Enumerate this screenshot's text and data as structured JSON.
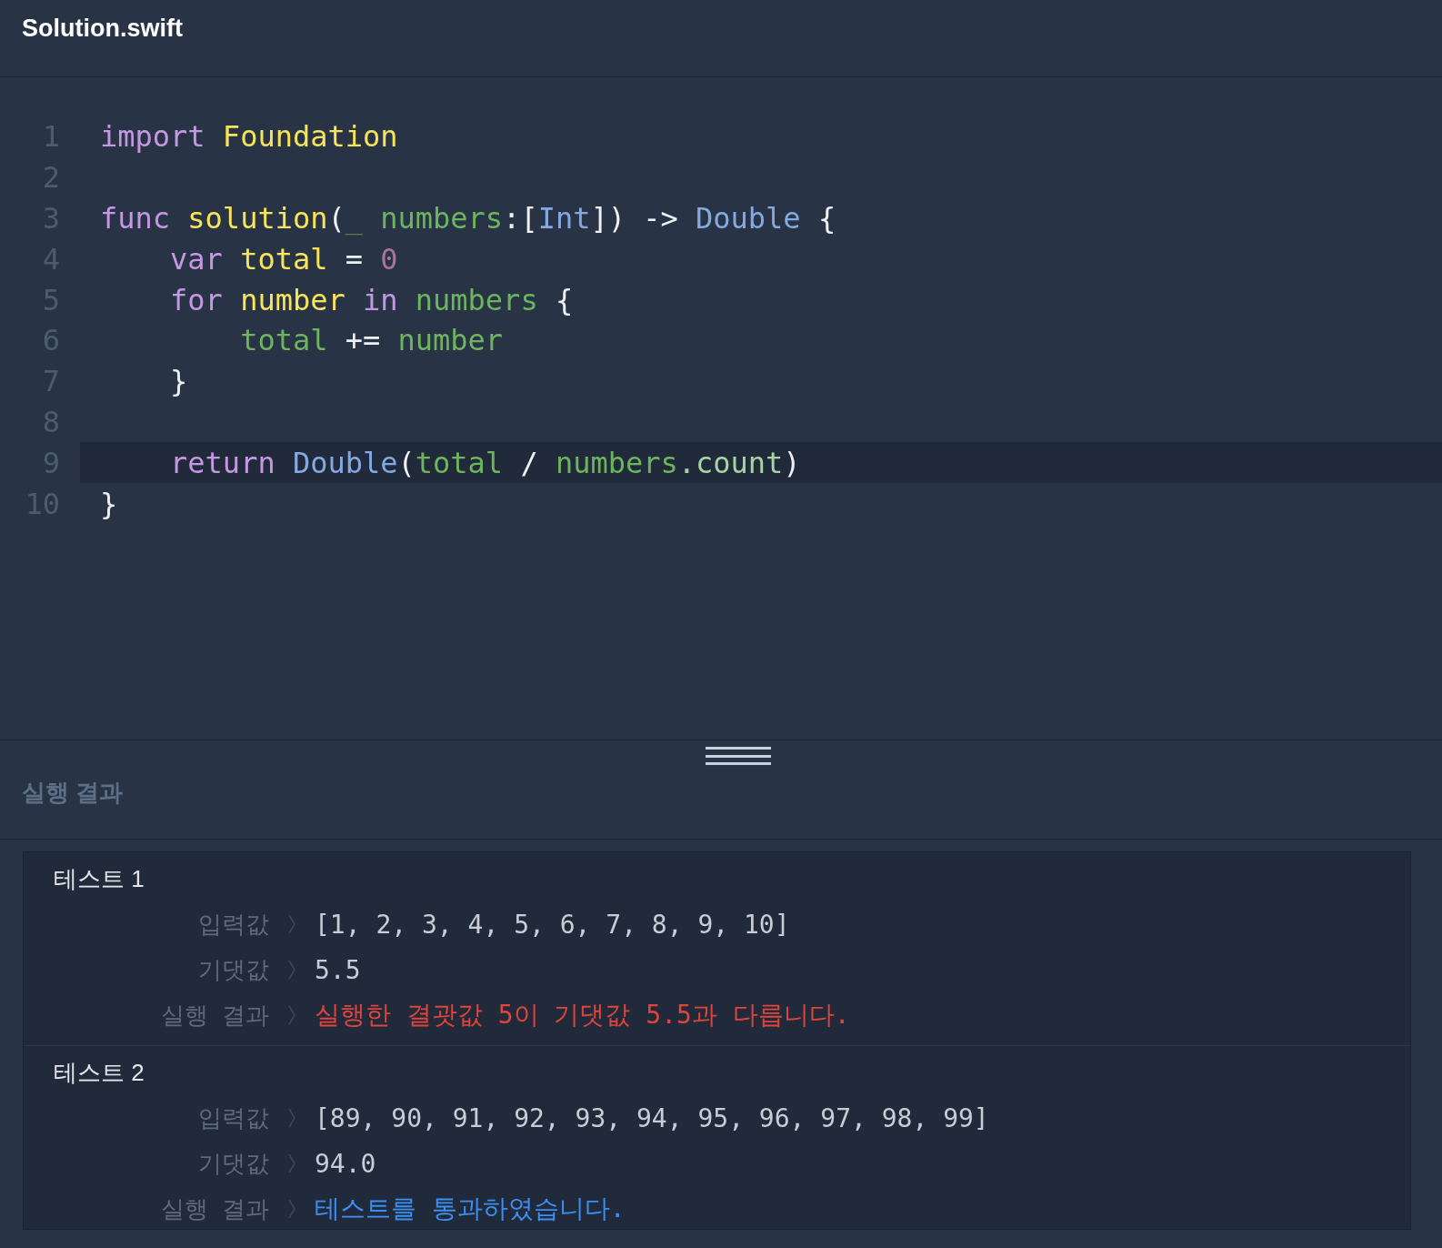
{
  "file_tab": {
    "title": "Solution.swift"
  },
  "editor": {
    "lines": [
      {
        "number": "1",
        "highlighted": false,
        "tokens": [
          {
            "kind": "keyword",
            "text": "import"
          },
          {
            "kind": "ident",
            "text": " Foundation"
          }
        ]
      },
      {
        "number": "2",
        "highlighted": false
      },
      {
        "number": "3",
        "highlighted": false,
        "tokens": [
          {
            "kind": "keyword",
            "text": "func"
          },
          {
            "kind": "ident",
            "text": " solution"
          },
          {
            "kind": "plain",
            "text": "("
          },
          {
            "kind": "dim",
            "text": "_"
          },
          {
            "kind": "var",
            "text": " numbers"
          },
          {
            "kind": "plain",
            "text": ":["
          },
          {
            "kind": "type",
            "text": "Int"
          },
          {
            "kind": "plain",
            "text": "]) -> "
          },
          {
            "kind": "type",
            "text": "Double"
          },
          {
            "kind": "plain",
            "text": " {"
          }
        ]
      },
      {
        "number": "4",
        "highlighted": false,
        "tokens": [
          {
            "kind": "keyword",
            "text": "    var"
          },
          {
            "kind": "ident",
            "text": " total"
          },
          {
            "kind": "plain",
            "text": " = "
          },
          {
            "kind": "number",
            "text": "0"
          }
        ]
      },
      {
        "number": "5",
        "highlighted": false,
        "tokens": [
          {
            "kind": "keyword",
            "text": "    for"
          },
          {
            "kind": "ident",
            "text": " number"
          },
          {
            "kind": "keyword",
            "text": " in"
          },
          {
            "kind": "var",
            "text": " numbers"
          },
          {
            "kind": "plain",
            "text": " {"
          }
        ]
      },
      {
        "number": "6",
        "highlighted": false,
        "tokens": [
          {
            "kind": "var",
            "text": "        total"
          },
          {
            "kind": "plain",
            "text": " += "
          },
          {
            "kind": "var",
            "text": "number"
          }
        ]
      },
      {
        "number": "7",
        "highlighted": false,
        "tokens": [
          {
            "kind": "plain",
            "text": "    }"
          }
        ]
      },
      {
        "number": "8",
        "highlighted": false
      },
      {
        "number": "9",
        "highlighted": true,
        "tokens": [
          {
            "kind": "keyword",
            "text": "    return"
          },
          {
            "kind": "type",
            "text": " Double"
          },
          {
            "kind": "plain",
            "text": "("
          },
          {
            "kind": "var",
            "text": "total"
          },
          {
            "kind": "plain",
            "text": " / "
          },
          {
            "kind": "var",
            "text": "numbers"
          },
          {
            "kind": "member",
            "text": ".count"
          },
          {
            "kind": "plain",
            "text": ")"
          }
        ]
      },
      {
        "number": "10",
        "highlighted": false,
        "tokens": [
          {
            "kind": "plain",
            "text": "}"
          }
        ]
      }
    ]
  },
  "results": {
    "title": "실행 결과",
    "tests": [
      {
        "title": "테스트 1",
        "rows": [
          {
            "label": "입력값",
            "value": "[1, 2, 3, 4, 5, 6, 7, 8, 9, 10]",
            "kind": "plain"
          },
          {
            "label": "기댓값",
            "value": "5.5",
            "kind": "plain"
          },
          {
            "label": "실행 결과",
            "value": "실행한 결괏값 5이 기댓값 5.5과 다릅니다.",
            "kind": "error"
          }
        ]
      },
      {
        "title": "테스트 2",
        "rows": [
          {
            "label": "입력값",
            "value": "[89, 90, 91, 92, 93, 94, 95, 96, 97, 98, 99]",
            "kind": "plain"
          },
          {
            "label": "기댓값",
            "value": "94.0",
            "kind": "plain"
          },
          {
            "label": "실행 결과",
            "value": "테스트를 통과하였습니다.",
            "kind": "success"
          }
        ]
      }
    ]
  }
}
